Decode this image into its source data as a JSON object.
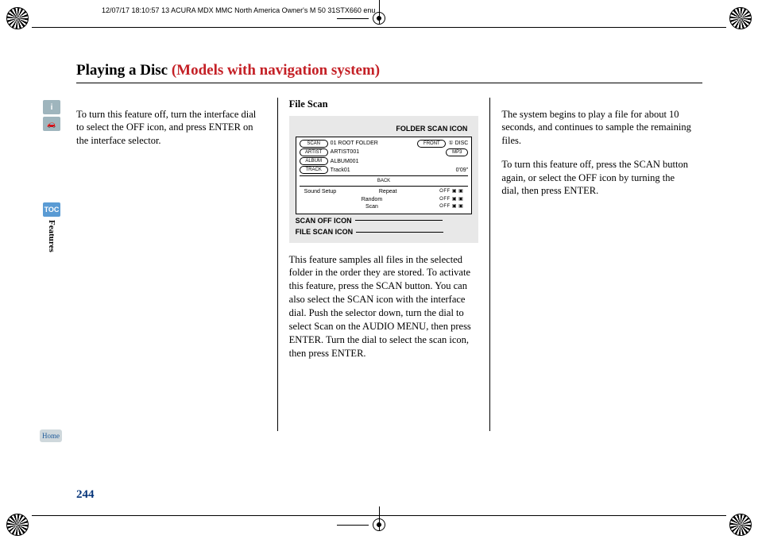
{
  "header_stamp": "12/07/17 18:10:57  13 ACURA MDX MMC North America Owner's M 50 31STX660 enu",
  "sidebar": {
    "info": "i",
    "car": "⛍",
    "toc": "TOC",
    "section_label": "Features",
    "home": "Home"
  },
  "title": {
    "main": "Playing a Disc ",
    "sub": "(Models with navigation system)"
  },
  "col1": {
    "p1": "To turn this feature off, turn the interface dial to select the OFF icon, and press ENTER on the interface selector."
  },
  "col2": {
    "heading": "File Scan",
    "diagram": {
      "top_label": "FOLDER SCAN ICON",
      "scan_off_label": "SCAN OFF ICON",
      "file_scan_label": "FILE SCAN ICON",
      "row_scan": "SCAN",
      "row_folder": "01 ROOT FOLDER",
      "row_front": "FRONT",
      "row_disc": "① DISC",
      "row_mp3": "MP3",
      "row_artist_lbl": "ARTIST",
      "row_artist": "ARTIST001",
      "row_album_lbl": "ALBUM",
      "row_album": "ALBUM001",
      "row_track_lbl": "TRACK",
      "row_track": "Track01",
      "row_time": "0'09''",
      "row_back": "BACK",
      "menu_sound": "Sound Setup",
      "menu_repeat": "Repeat",
      "menu_random": "Random",
      "menu_scan": "Scan",
      "icons_off": "OFF ▣ ▣"
    },
    "p1": "This feature samples all files in the selected folder in the order they are stored. To activate this feature, press the SCAN button. You can also select the SCAN icon with the interface dial. Push the selector down, turn the dial to select Scan on the AUDIO MENU, then press ENTER. Turn the dial to select the scan icon, then press ENTER."
  },
  "col3": {
    "p1": "The system begins to play a file for about 10 seconds, and continues to sample the remaining files.",
    "p2": "To turn this feature off, press the SCAN button again, or select the OFF icon by turning the dial, then press ENTER."
  },
  "page_number": "244"
}
